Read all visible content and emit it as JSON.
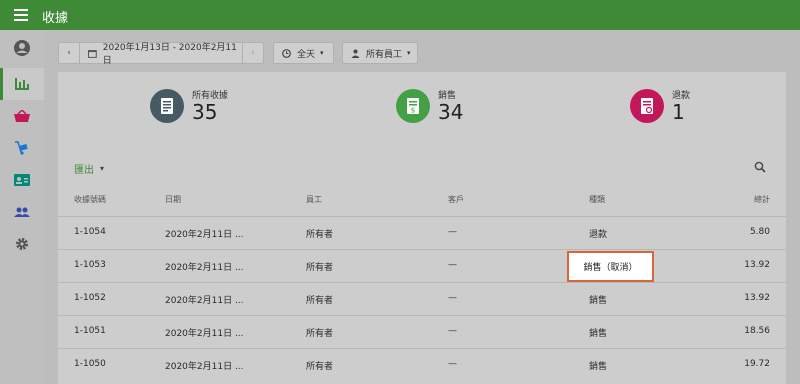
{
  "app": {
    "title": "收據"
  },
  "filters": {
    "date_range": "2020年1月13日 - 2020年2月11日",
    "time": "全天",
    "employee": "所有員工"
  },
  "summary": {
    "all_label": "所有收據",
    "all_count": "35",
    "sales_label": "銷售",
    "sales_count": "34",
    "refunds_label": "退款",
    "refunds_count": "1"
  },
  "table": {
    "export_label": "匯出",
    "headers": {
      "receipt": "收據號碼",
      "date": "日期",
      "employee": "員工",
      "customer": "客戶",
      "type": "種類",
      "total": "總計"
    },
    "rows": [
      {
        "receipt": "1-1054",
        "date": "2020年2月11日 ...",
        "employee": "所有者",
        "customer": "—",
        "type": "退款",
        "total": "5.80"
      },
      {
        "receipt": "1-1053",
        "date": "2020年2月11日 ...",
        "employee": "所有者",
        "customer": "—",
        "type": "銷售（取消）",
        "total": "13.92"
      },
      {
        "receipt": "1-1052",
        "date": "2020年2月11日 ...",
        "employee": "所有者",
        "customer": "—",
        "type": "銷售",
        "total": "13.92"
      },
      {
        "receipt": "1-1051",
        "date": "2020年2月11日 ...",
        "employee": "所有者",
        "customer": "—",
        "type": "銷售",
        "total": "18.56"
      },
      {
        "receipt": "1-1050",
        "date": "2020年2月11日 ...",
        "employee": "所有者",
        "customer": "—",
        "type": "銷售",
        "total": "19.72"
      }
    ]
  },
  "colors": {
    "accent": "#3e8a36",
    "sales": "#43a047",
    "refund": "#c2185b",
    "receipts": "#455a64",
    "highlight_border": "#d9653a"
  }
}
